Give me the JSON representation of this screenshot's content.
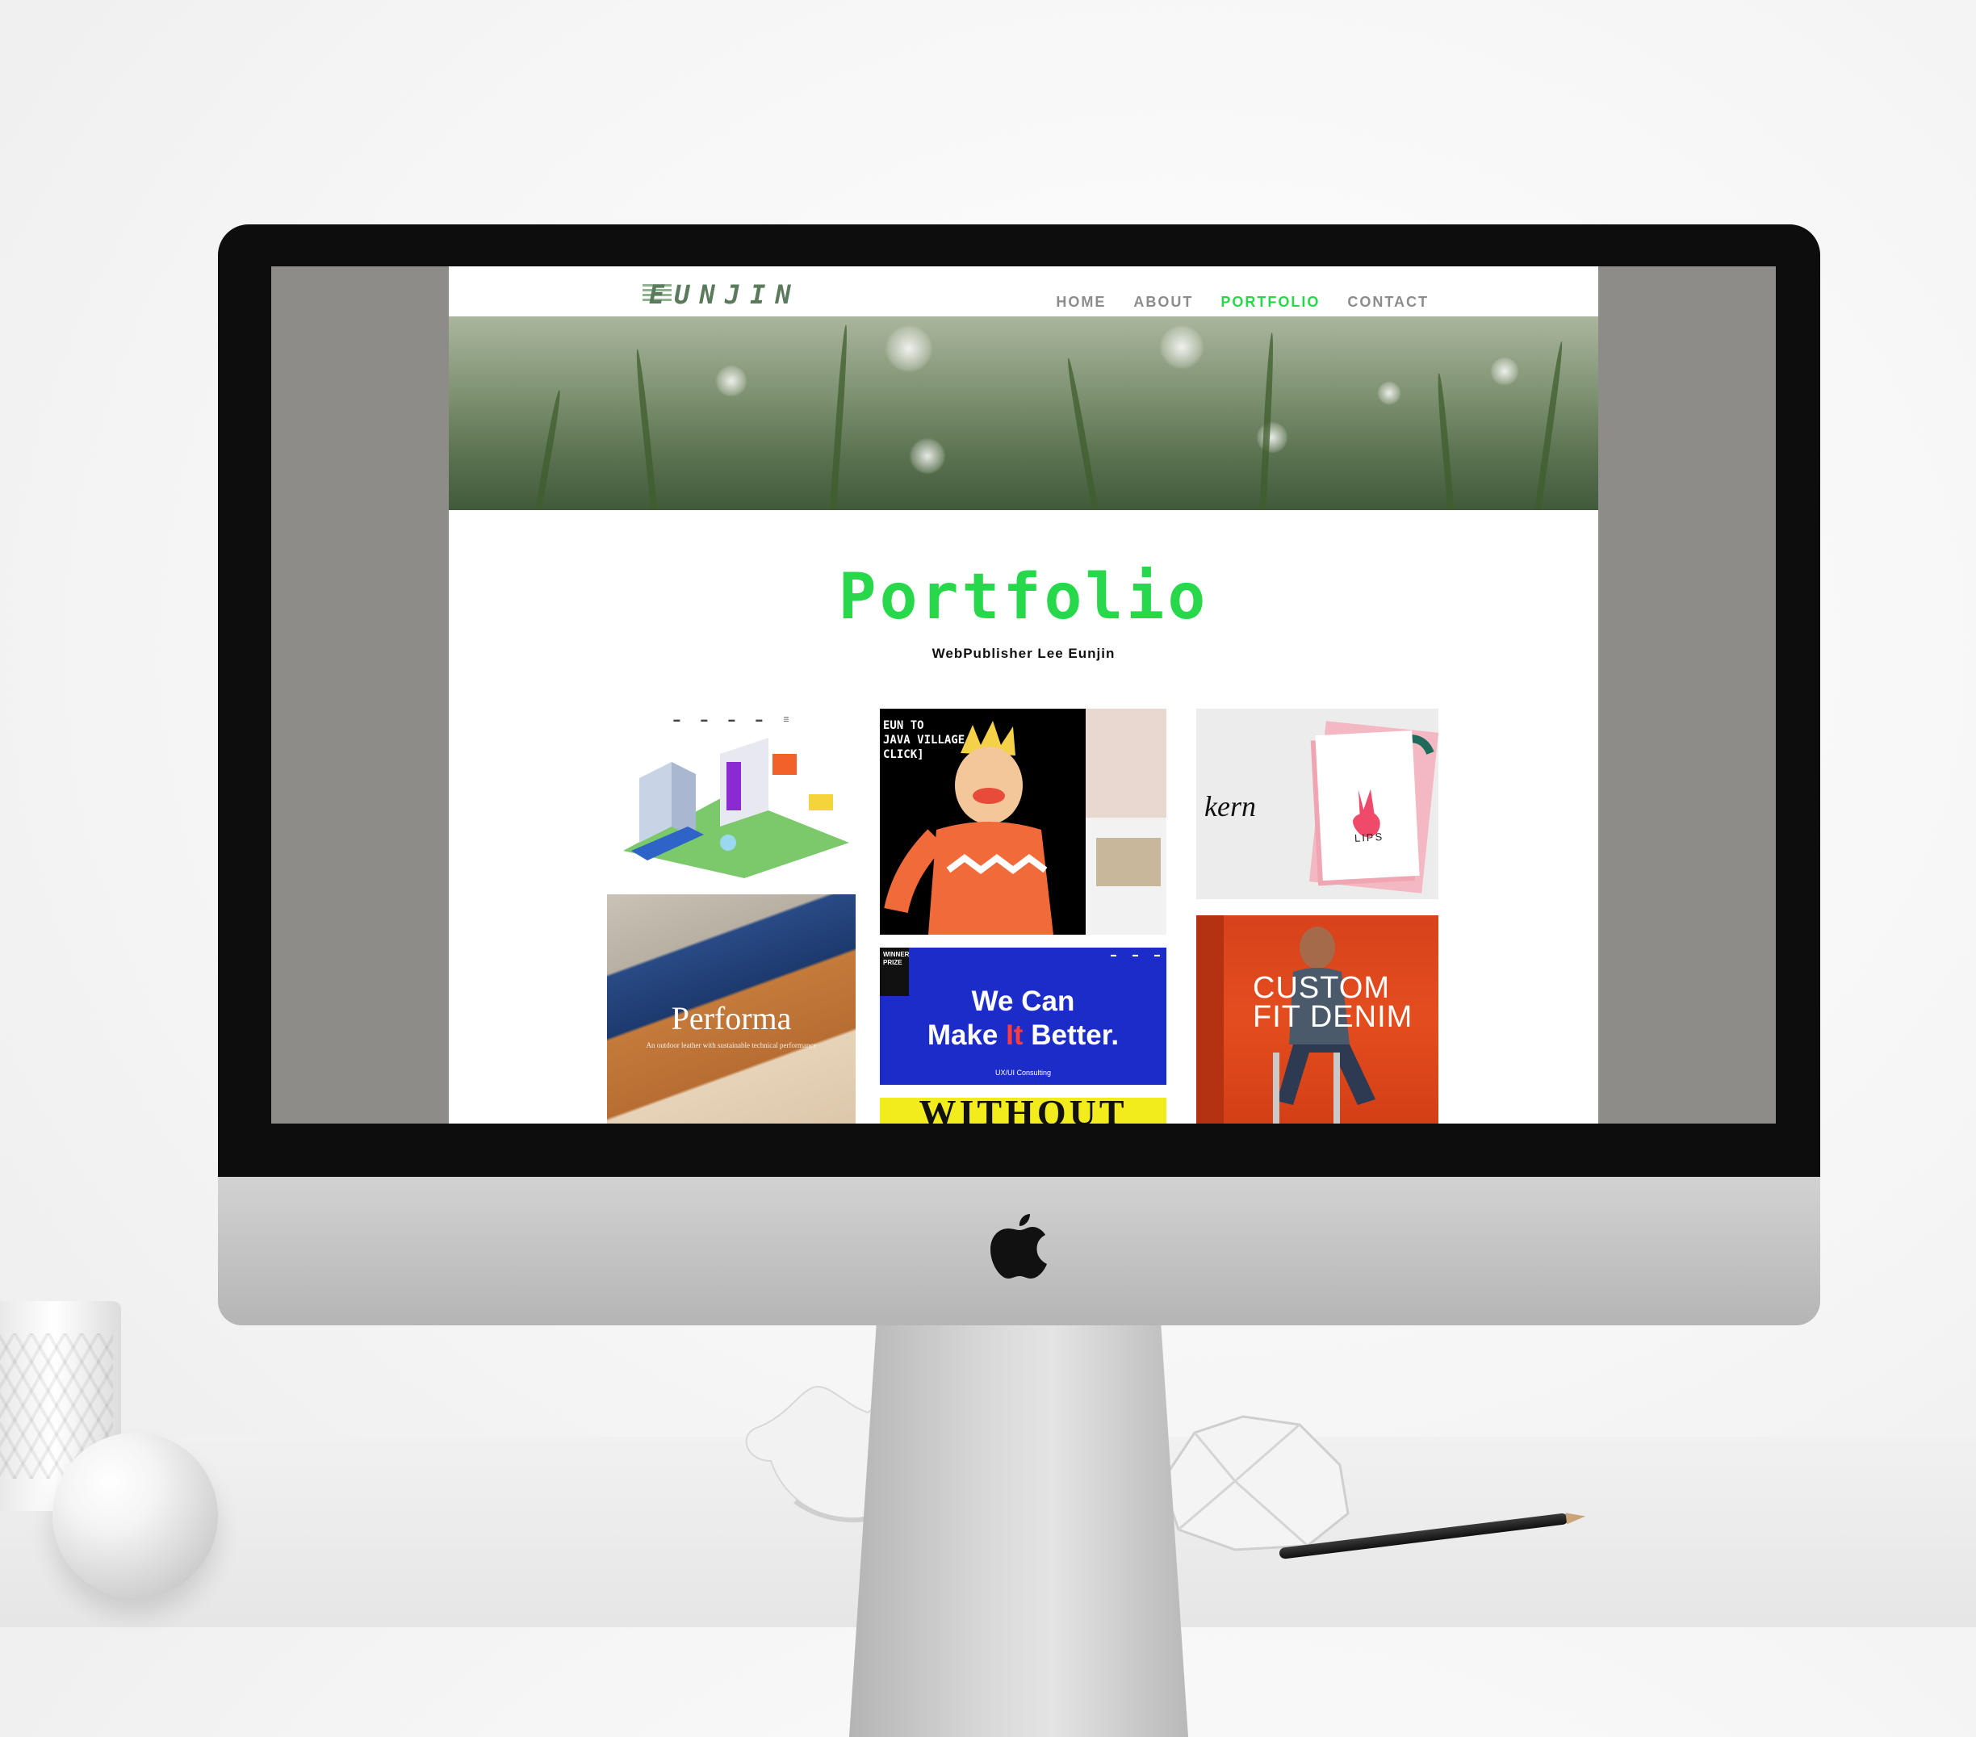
{
  "brand": {
    "logo_text": "EUNJIN"
  },
  "nav": {
    "items": [
      {
        "label": "HOME",
        "active": false
      },
      {
        "label": "ABOUT",
        "active": false
      },
      {
        "label": "PORTFOLIO",
        "active": true
      },
      {
        "label": "CONTACT",
        "active": false
      }
    ]
  },
  "main": {
    "title": "Portfolio",
    "subtitle": "WebPublisher Lee Eunjin"
  },
  "portfolio": {
    "performa": {
      "title": "Performa",
      "tagline": "An outdoor leather with sustainable technical performance"
    },
    "character": {
      "lines": [
        "EUN TO",
        "JAVA VILLAGE",
        "CLICK]"
      ]
    },
    "wecan": {
      "line1": "We Can",
      "line2_a": "Make ",
      "line2_b": "It",
      "line2_c": " Better.",
      "caption": "UX/UI Consulting",
      "badge": "WINNER PRIZE"
    },
    "without": {
      "text": "WITHOUT"
    },
    "kern": {
      "brand": "kern",
      "card": "LIPS"
    },
    "denim": {
      "line1": "CUSTOM",
      "line2": "FIT DENIM"
    }
  },
  "colors": {
    "accent": "#27d84a",
    "nav_inactive": "#8c8c8c",
    "bezel": "#0d0d0d",
    "screen_margin": "#8e8c89"
  },
  "icons": [
    "apple-logo-icon",
    "hamburger-menu-icon"
  ]
}
